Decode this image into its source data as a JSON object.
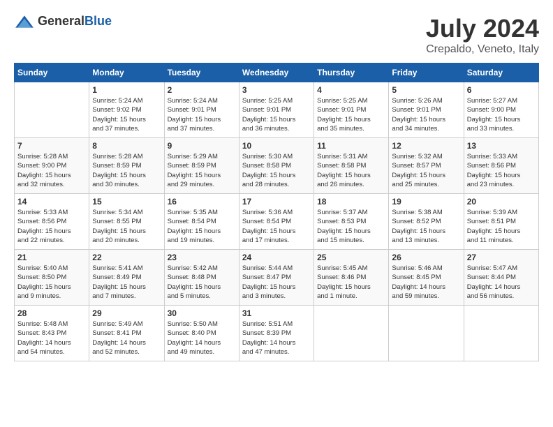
{
  "logo": {
    "general_text": "General",
    "blue_text": "Blue"
  },
  "header": {
    "month_year": "July 2024",
    "location": "Crepaldo, Veneto, Italy"
  },
  "weekdays": [
    "Sunday",
    "Monday",
    "Tuesday",
    "Wednesday",
    "Thursday",
    "Friday",
    "Saturday"
  ],
  "weeks": [
    [
      {
        "day": "",
        "info": ""
      },
      {
        "day": "1",
        "info": "Sunrise: 5:24 AM\nSunset: 9:02 PM\nDaylight: 15 hours\nand 37 minutes."
      },
      {
        "day": "2",
        "info": "Sunrise: 5:24 AM\nSunset: 9:01 PM\nDaylight: 15 hours\nand 37 minutes."
      },
      {
        "day": "3",
        "info": "Sunrise: 5:25 AM\nSunset: 9:01 PM\nDaylight: 15 hours\nand 36 minutes."
      },
      {
        "day": "4",
        "info": "Sunrise: 5:25 AM\nSunset: 9:01 PM\nDaylight: 15 hours\nand 35 minutes."
      },
      {
        "day": "5",
        "info": "Sunrise: 5:26 AM\nSunset: 9:01 PM\nDaylight: 15 hours\nand 34 minutes."
      },
      {
        "day": "6",
        "info": "Sunrise: 5:27 AM\nSunset: 9:00 PM\nDaylight: 15 hours\nand 33 minutes."
      }
    ],
    [
      {
        "day": "7",
        "info": "Sunrise: 5:28 AM\nSunset: 9:00 PM\nDaylight: 15 hours\nand 32 minutes."
      },
      {
        "day": "8",
        "info": "Sunrise: 5:28 AM\nSunset: 8:59 PM\nDaylight: 15 hours\nand 30 minutes."
      },
      {
        "day": "9",
        "info": "Sunrise: 5:29 AM\nSunset: 8:59 PM\nDaylight: 15 hours\nand 29 minutes."
      },
      {
        "day": "10",
        "info": "Sunrise: 5:30 AM\nSunset: 8:58 PM\nDaylight: 15 hours\nand 28 minutes."
      },
      {
        "day": "11",
        "info": "Sunrise: 5:31 AM\nSunset: 8:58 PM\nDaylight: 15 hours\nand 26 minutes."
      },
      {
        "day": "12",
        "info": "Sunrise: 5:32 AM\nSunset: 8:57 PM\nDaylight: 15 hours\nand 25 minutes."
      },
      {
        "day": "13",
        "info": "Sunrise: 5:33 AM\nSunset: 8:56 PM\nDaylight: 15 hours\nand 23 minutes."
      }
    ],
    [
      {
        "day": "14",
        "info": "Sunrise: 5:33 AM\nSunset: 8:56 PM\nDaylight: 15 hours\nand 22 minutes."
      },
      {
        "day": "15",
        "info": "Sunrise: 5:34 AM\nSunset: 8:55 PM\nDaylight: 15 hours\nand 20 minutes."
      },
      {
        "day": "16",
        "info": "Sunrise: 5:35 AM\nSunset: 8:54 PM\nDaylight: 15 hours\nand 19 minutes."
      },
      {
        "day": "17",
        "info": "Sunrise: 5:36 AM\nSunset: 8:54 PM\nDaylight: 15 hours\nand 17 minutes."
      },
      {
        "day": "18",
        "info": "Sunrise: 5:37 AM\nSunset: 8:53 PM\nDaylight: 15 hours\nand 15 minutes."
      },
      {
        "day": "19",
        "info": "Sunrise: 5:38 AM\nSunset: 8:52 PM\nDaylight: 15 hours\nand 13 minutes."
      },
      {
        "day": "20",
        "info": "Sunrise: 5:39 AM\nSunset: 8:51 PM\nDaylight: 15 hours\nand 11 minutes."
      }
    ],
    [
      {
        "day": "21",
        "info": "Sunrise: 5:40 AM\nSunset: 8:50 PM\nDaylight: 15 hours\nand 9 minutes."
      },
      {
        "day": "22",
        "info": "Sunrise: 5:41 AM\nSunset: 8:49 PM\nDaylight: 15 hours\nand 7 minutes."
      },
      {
        "day": "23",
        "info": "Sunrise: 5:42 AM\nSunset: 8:48 PM\nDaylight: 15 hours\nand 5 minutes."
      },
      {
        "day": "24",
        "info": "Sunrise: 5:44 AM\nSunset: 8:47 PM\nDaylight: 15 hours\nand 3 minutes."
      },
      {
        "day": "25",
        "info": "Sunrise: 5:45 AM\nSunset: 8:46 PM\nDaylight: 15 hours\nand 1 minute."
      },
      {
        "day": "26",
        "info": "Sunrise: 5:46 AM\nSunset: 8:45 PM\nDaylight: 14 hours\nand 59 minutes."
      },
      {
        "day": "27",
        "info": "Sunrise: 5:47 AM\nSunset: 8:44 PM\nDaylight: 14 hours\nand 56 minutes."
      }
    ],
    [
      {
        "day": "28",
        "info": "Sunrise: 5:48 AM\nSunset: 8:43 PM\nDaylight: 14 hours\nand 54 minutes."
      },
      {
        "day": "29",
        "info": "Sunrise: 5:49 AM\nSunset: 8:41 PM\nDaylight: 14 hours\nand 52 minutes."
      },
      {
        "day": "30",
        "info": "Sunrise: 5:50 AM\nSunset: 8:40 PM\nDaylight: 14 hours\nand 49 minutes."
      },
      {
        "day": "31",
        "info": "Sunrise: 5:51 AM\nSunset: 8:39 PM\nDaylight: 14 hours\nand 47 minutes."
      },
      {
        "day": "",
        "info": ""
      },
      {
        "day": "",
        "info": ""
      },
      {
        "day": "",
        "info": ""
      }
    ]
  ]
}
